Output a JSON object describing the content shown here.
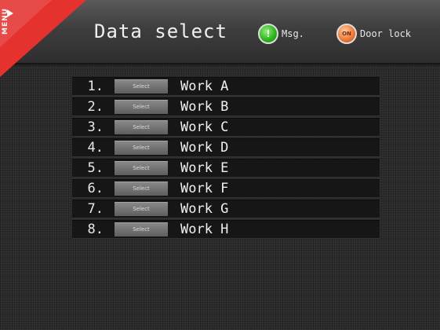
{
  "header": {
    "title": "Data select",
    "menu_label": "MENU",
    "indicators": [
      {
        "icon": "message-icon",
        "glyph": "!",
        "label": "Msg.",
        "color": "#2fb81e"
      },
      {
        "icon": "door-lock-icon",
        "glyph": "ON",
        "label": "Door lock",
        "color": "#f07a38"
      }
    ]
  },
  "list": {
    "select_label": "Select",
    "items": [
      {
        "num": "1.",
        "name": "Work A"
      },
      {
        "num": "2.",
        "name": "Work B"
      },
      {
        "num": "3.",
        "name": "Work C"
      },
      {
        "num": "4.",
        "name": "Work D"
      },
      {
        "num": "5.",
        "name": "Work E"
      },
      {
        "num": "6.",
        "name": "Work F"
      },
      {
        "num": "7.",
        "name": "Work G"
      },
      {
        "num": "8.",
        "name": "Work H"
      }
    ]
  },
  "colors": {
    "menu_tab": "#e5322e",
    "background": "#2b2b2b",
    "row": "#161616"
  }
}
